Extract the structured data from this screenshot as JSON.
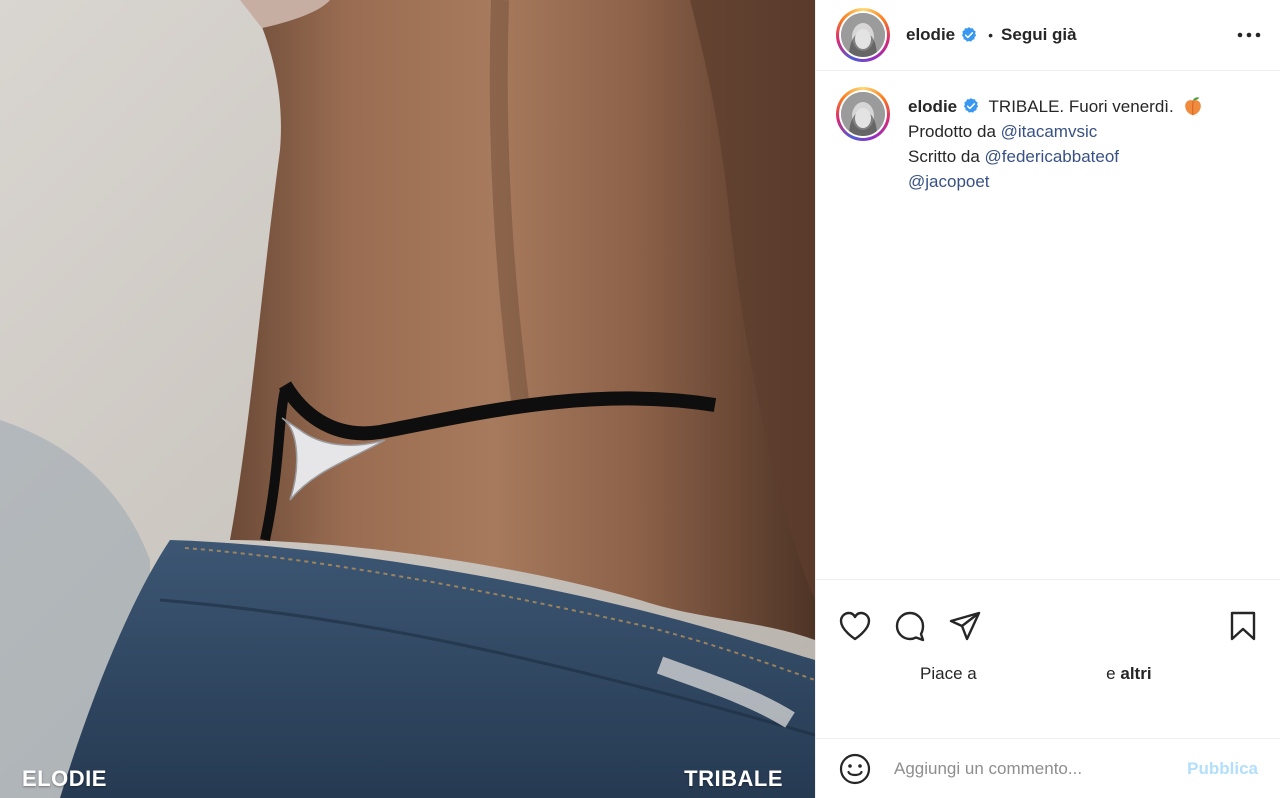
{
  "post": {
    "overlay_left": "ELODIE",
    "overlay_right": "TRIBALE"
  },
  "header": {
    "username": "elodie",
    "separator": "•",
    "follow_label": "Segui già"
  },
  "caption": {
    "username": "elodie",
    "line1": "TRIBALE. Fuori venerdì.",
    "line2_prefix": "Prodotto da",
    "mention1": "@itacamvsic",
    "line3_prefix": "Scritto da",
    "mention2": "@federicabbateof",
    "mention3": "@jacopoet"
  },
  "likes": {
    "prefix": "Piace a",
    "suffix": "e",
    "others": "altri"
  },
  "comment": {
    "placeholder": "Aggiungi un commento...",
    "post_label": "Pubblica"
  },
  "icons": {
    "verified": "verified-badge-icon",
    "more": "more-options-icon",
    "like": "heart-icon",
    "comment": "comment-icon",
    "share": "share-icon",
    "save": "bookmark-icon",
    "emoji": "emoji-icon",
    "peach": "peach-emoji-icon"
  },
  "colors": {
    "verified": "#3897f0",
    "mention": "#385185",
    "post_button": "#b2dffc"
  }
}
